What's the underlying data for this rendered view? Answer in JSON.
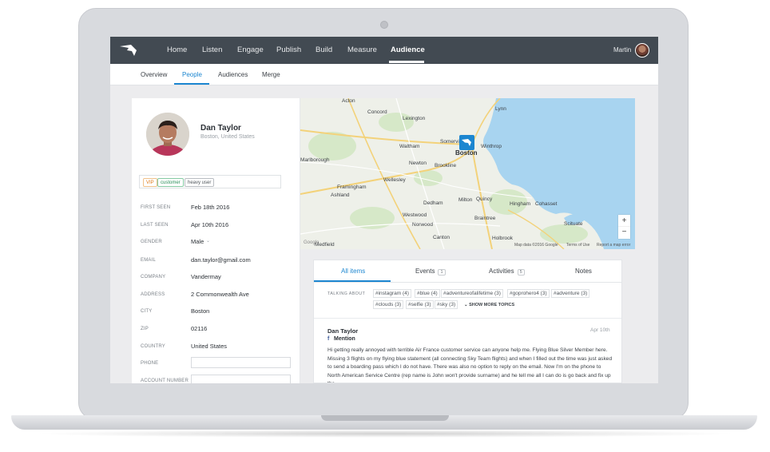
{
  "topnav": {
    "items": [
      {
        "label": "Home"
      },
      {
        "label": "Listen"
      },
      {
        "label": "Engage"
      },
      {
        "label": "Publish"
      },
      {
        "label": "Build"
      },
      {
        "label": "Measure"
      },
      {
        "label": "Audience",
        "active": true
      }
    ],
    "user_name": "Martin"
  },
  "subnav": {
    "items": [
      {
        "label": "Overview"
      },
      {
        "label": "People",
        "active": true
      },
      {
        "label": "Audiences"
      },
      {
        "label": "Merge"
      }
    ]
  },
  "profile": {
    "name": "Dan Taylor",
    "location": "Boston, United States",
    "tags": [
      "VIP",
      "customer",
      "heavy user"
    ],
    "fields": [
      {
        "label": "FIRST SEEN",
        "value": "Feb 18th 2016"
      },
      {
        "label": "LAST SEEN",
        "value": "Apr 10th 2016"
      },
      {
        "label": "GENDER",
        "value": "Male"
      },
      {
        "label": "EMAIL",
        "value": "dan.taylor@gmail.com"
      },
      {
        "label": "COMPANY",
        "value": "Vandermay"
      },
      {
        "label": "ADDRESS",
        "value": "2 Commonwealth Ave"
      },
      {
        "label": "CITY",
        "value": "Boston"
      },
      {
        "label": "ZIP",
        "value": "02116"
      },
      {
        "label": "COUNTRY",
        "value": "United States"
      },
      {
        "label": "PHONE",
        "value": ""
      },
      {
        "label": "ACCOUNT NUMBER",
        "value": ""
      }
    ]
  },
  "map": {
    "labels": [
      "Acton",
      "Concord",
      "Lexington",
      "Lynn",
      "Waltham",
      "Somerville",
      "Boston",
      "Winthrop",
      "Newton",
      "Brookline",
      "Marlborough",
      "Wellesley",
      "Framingham",
      "Ashland",
      "Milton",
      "Quincy",
      "Dedham",
      "Hingham",
      "Cohasset",
      "Westwood",
      "Braintree",
      "Norwood",
      "Canton",
      "Scituate",
      "Medfield",
      "Holbrook"
    ],
    "zoom_in": "+",
    "zoom_out": "−",
    "attribution": "Map data ©2016 Google",
    "terms": "Terms of Use",
    "report": "Report a map error",
    "google": "Google"
  },
  "feed": {
    "tabs": [
      {
        "label": "All items",
        "active": true
      },
      {
        "label": "Events",
        "count": "1"
      },
      {
        "label": "Activities",
        "count": "5"
      },
      {
        "label": "Notes"
      }
    ],
    "talking_about_label": "TALKING ABOUT",
    "topics": [
      "#instagram (4)",
      "#blue (4)",
      "#adventureofalifetime (3)",
      "#goprohero4 (3)",
      "#adventure (3)",
      "#clouds (3)",
      "#selfie (3)",
      "#sky (3)"
    ],
    "show_more": "SHOW MORE TOPICS",
    "post": {
      "author": "Dan Taylor",
      "date": "Apr 10th",
      "network_icon": "f",
      "type": "Mention",
      "text": "Hi getting really annoyed with terrible Air France customer service can anyone help me. Flying Blue Silver Member here. Missing 3 flights on my flying blue statement (all connecting Sky Team flights) and when I filled out the time was just asked to send a boarding pass which I do not have. There was also no option to reply on the email. Now I'm on the phone to North American Service Centre (rep name is John won't provide surname) and he tell me all I can do is go back and fix up the ..."
    }
  },
  "colors": {
    "accent": "#1c86d0",
    "nav_bg": "#424a52",
    "water": "#a8d4f0",
    "facebook": "#3b5998"
  }
}
